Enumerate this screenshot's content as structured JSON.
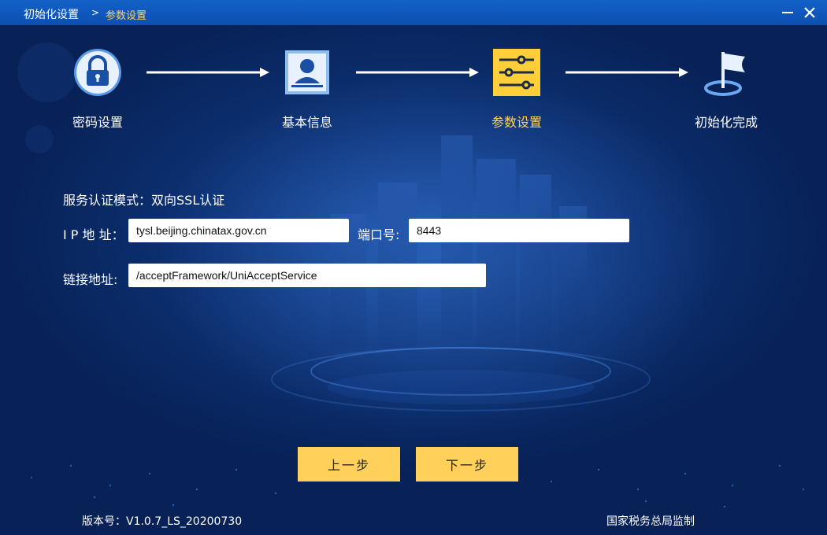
{
  "titlebar": {
    "breadcrumb_root": "初始化设置",
    "breadcrumb_sep": ">",
    "breadcrumb_current": "参数设置"
  },
  "steps": [
    {
      "label": "密码设置",
      "icon": "lock-icon",
      "active": false
    },
    {
      "label": "基本信息",
      "icon": "profile-card-icon",
      "active": false
    },
    {
      "label": "参数设置",
      "icon": "sliders-icon",
      "active": true
    },
    {
      "label": "初始化完成",
      "icon": "flag-icon",
      "active": false
    }
  ],
  "form": {
    "auth_mode_text": "服务认证模式：双向SSL认证",
    "ip_label": "I P 地 址：",
    "ip_value": "tysl.beijing.chinatax.gov.cn",
    "port_label": "端口号:",
    "port_value": "8443",
    "url_label": "链接地址:",
    "url_value": "/acceptFramework/UniAcceptService"
  },
  "buttons": {
    "prev": "上一步",
    "next": "下一步"
  },
  "footer": {
    "version": "版本号：V1.0.7_LS_20200730",
    "supervisor": "国家税务总局监制"
  },
  "colors": {
    "accent": "#ffd45a",
    "button": "#ffd05a",
    "titlebar": "#1361c9",
    "background": "#0a2a66"
  }
}
